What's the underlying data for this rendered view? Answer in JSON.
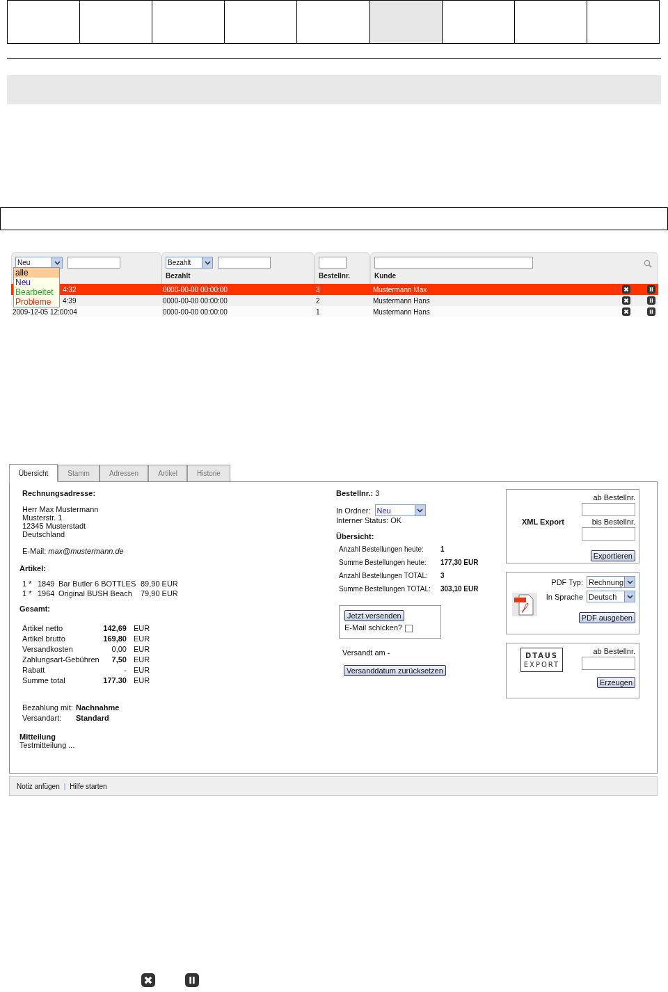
{
  "top_cells": [
    {
      "selected": false
    },
    {
      "selected": false
    },
    {
      "selected": false
    },
    {
      "selected": false
    },
    {
      "selected": false
    },
    {
      "selected": true
    },
    {
      "selected": false
    },
    {
      "selected": false
    },
    {
      "selected": false
    }
  ],
  "order_list": {
    "columns": [
      {
        "kind": "status",
        "select": "Neu"
      },
      {
        "kind": "paid",
        "select": "Bezahlt",
        "label": "Bezahlt"
      },
      {
        "kind": "number",
        "label": "Bestellnr."
      },
      {
        "kind": "customer",
        "label": "Kunde"
      }
    ],
    "status_dropdown": {
      "options": [
        {
          "label": "alle",
          "selected": true
        },
        {
          "label": "Neu",
          "selected": false,
          "color": "#2222cc"
        },
        {
          "label": "Bearbeitet",
          "selected": false,
          "color": "#33a033"
        },
        {
          "label": "Probleme",
          "selected": false,
          "color": "#e02a1a"
        }
      ]
    },
    "rows": [
      {
        "selected": true,
        "date_tail": "4:32",
        "paid": "0000-00-00 00:00:00",
        "number": "3",
        "customer": "Mustermann Max"
      },
      {
        "selected": false,
        "date_tail": "4:39",
        "paid": "0000-00-00 00:00:00",
        "number": "2",
        "customer": "Mustermann Hans"
      },
      {
        "selected": false,
        "date": "2009-12-05 12:00:04",
        "paid": "0000-00-00 00:00:00",
        "number": "1",
        "customer": "Mustermann Hans"
      }
    ]
  },
  "detail": {
    "tabs": [
      {
        "label": "Übersicht",
        "selected": true
      },
      {
        "label": "Stamm",
        "selected": false
      },
      {
        "label": "Adressen",
        "selected": false
      },
      {
        "label": "Artikel",
        "selected": false
      },
      {
        "label": "Historie",
        "selected": false
      }
    ],
    "billing": {
      "heading": "Rechnungsadresse:",
      "address": [
        "Herr Max Mustermann",
        "Musterstr. 1",
        "12345 Musterstadt",
        "Deutschland"
      ],
      "email_label": "E-Mail:",
      "email": "max@mustermann.de"
    },
    "articles": {
      "heading": "Artikel:",
      "items": [
        {
          "qty": "1 *",
          "sku": "1849",
          "name": "Bar Butler 6 BOTTLES",
          "price": "89,90 EUR"
        },
        {
          "qty": "1 *",
          "sku": "1964",
          "name": "Original BUSH Beach",
          "price": "79,90 EUR"
        }
      ]
    },
    "totals": {
      "heading": "Gesamt:",
      "rows": [
        {
          "label": "Artikel netto",
          "value": "142,69",
          "currency": "EUR",
          "bold": true
        },
        {
          "label": "Artikel brutto",
          "value": "169,80",
          "currency": "EUR",
          "bold": true
        },
        {
          "label": "Versandkosten",
          "value": "0,00",
          "currency": "EUR",
          "bold": false
        },
        {
          "label": "Zahlungsart-Gebühren",
          "value": "7,50",
          "currency": "EUR",
          "bold": true
        },
        {
          "label": "Rabatt",
          "value": "-",
          "currency": "EUR",
          "bold": false
        },
        {
          "label": "Summe total",
          "value": "177.30",
          "currency": "EUR",
          "bold": true
        }
      ]
    },
    "payment": [
      {
        "label": "Bezahlung mit:",
        "value": "Nachnahme"
      },
      {
        "label": "Versandart:",
        "value": "Standard"
      }
    ],
    "message": {
      "heading": "Mitteilung",
      "text": "Testmitteilung ..."
    },
    "order": {
      "number_label": "Bestellnr.:",
      "number": "3",
      "folder_label": "In Ordner:",
      "folder": "Neu",
      "status": "Interner Status: OK"
    },
    "overview": {
      "heading": "Übersicht:",
      "rows": [
        {
          "label": "Anzahl Bestellungen heute:",
          "value": "1"
        },
        {
          "label": "Summe Bestellungen heute:",
          "value": "177,30 EUR"
        },
        {
          "label": "Anzahl Bestellungen TOTAL:",
          "value": "3"
        },
        {
          "label": "Summe Bestellungen TOTAL:",
          "value": "303,10 EUR"
        }
      ]
    },
    "shipping": {
      "button": "Jetzt versenden",
      "email_label": "E-Mail schicken?",
      "email_checked": false,
      "shipped": "Versandt am -",
      "reset_button": "Versanddatum zurücksetzen"
    },
    "xml_export": {
      "title": "XML Export",
      "from_label": "ab Bestellnr.",
      "to_label": "bis Bestellnr.",
      "button": "Exportieren"
    },
    "pdf_export": {
      "type_label": "PDF Typ:",
      "type": "Rechnung",
      "language_label": "In Sprache",
      "language": "Deutsch",
      "button": "PDF ausgeben"
    },
    "dtaus_export": {
      "logo": [
        "DTAUS",
        "EXPORT"
      ],
      "from_label": "ab Bestellnr.",
      "button": "Erzeugen"
    }
  },
  "footer": {
    "links": [
      "Notiz anfügen",
      "Hilfe starten"
    ],
    "separator": "|"
  }
}
